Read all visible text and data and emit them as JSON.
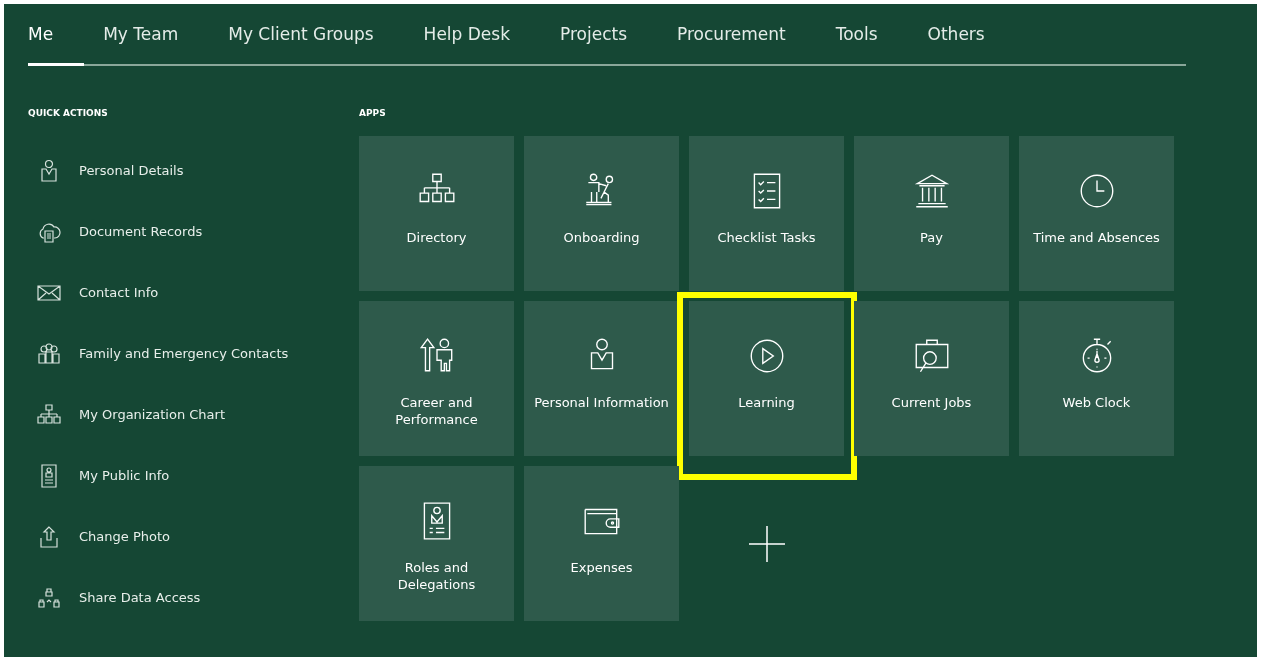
{
  "tabs": [
    {
      "label": "Me",
      "selected": true
    },
    {
      "label": "My Team",
      "selected": false
    },
    {
      "label": "My Client Groups",
      "selected": false
    },
    {
      "label": "Help Desk",
      "selected": false
    },
    {
      "label": "Projects",
      "selected": false
    },
    {
      "label": "Procurement",
      "selected": false
    },
    {
      "label": "Tools",
      "selected": false
    },
    {
      "label": "Others",
      "selected": false
    }
  ],
  "quick_actions": {
    "heading": "QUICK ACTIONS",
    "items": [
      {
        "label": "Personal Details"
      },
      {
        "label": "Document Records"
      },
      {
        "label": "Contact Info"
      },
      {
        "label": "Family and Emergency Contacts"
      },
      {
        "label": "My Organization Chart"
      },
      {
        "label": "My Public Info"
      },
      {
        "label": "Change Photo"
      },
      {
        "label": "Share Data Access"
      }
    ]
  },
  "apps": {
    "heading": "APPS",
    "tiles": [
      {
        "label": "Directory",
        "highlighted": false
      },
      {
        "label": "Onboarding",
        "highlighted": false
      },
      {
        "label": "Checklist Tasks",
        "highlighted": false
      },
      {
        "label": "Pay",
        "highlighted": false
      },
      {
        "label": "Time and Absences",
        "highlighted": false
      },
      {
        "label": "Career and Performance",
        "highlighted": false
      },
      {
        "label": "Personal Information",
        "highlighted": false
      },
      {
        "label": "Learning",
        "highlighted": true
      },
      {
        "label": "Current Jobs",
        "highlighted": false
      },
      {
        "label": "Web Clock",
        "highlighted": false
      },
      {
        "label": "Roles and Delegations",
        "highlighted": false
      },
      {
        "label": "Expenses",
        "highlighted": false
      }
    ]
  }
}
